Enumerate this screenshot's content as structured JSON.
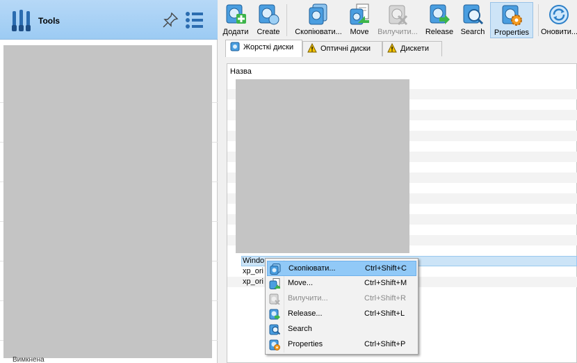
{
  "left_panel": {
    "title": "Tools",
    "bottom_text": "Вимкнена"
  },
  "toolbar": {
    "buttons": [
      {
        "label": "Додати",
        "icon": "add-disk-icon",
        "state": "normal"
      },
      {
        "label": "Create",
        "icon": "create-disk-icon",
        "state": "normal"
      },
      {
        "label": "Скопіювати...",
        "icon": "copy-disk-icon",
        "state": "normal"
      },
      {
        "label": "Move",
        "icon": "move-disk-icon",
        "state": "normal"
      },
      {
        "label": "Вилучити...",
        "icon": "remove-disk-icon",
        "state": "disabled"
      },
      {
        "label": "Release",
        "icon": "release-disk-icon",
        "state": "normal"
      },
      {
        "label": "Search",
        "icon": "search-disk-icon",
        "state": "normal"
      },
      {
        "label": "Properties",
        "icon": "properties-disk-icon",
        "state": "active"
      },
      {
        "label": "Оновити...",
        "icon": "refresh-icon",
        "state": "normal"
      }
    ]
  },
  "tabs": [
    {
      "label": "Жорсткі диски",
      "icon": "hard-disk-icon",
      "active": true
    },
    {
      "label": "Оптичні диски",
      "icon": "warning-icon",
      "active": false
    },
    {
      "label": "Дискети",
      "icon": "warning-icon",
      "active": false
    }
  ],
  "table": {
    "column_header": "Назва",
    "visible_rows": [
      "Windo",
      "xp_ori",
      "xp_ori"
    ]
  },
  "context_menu": {
    "items": [
      {
        "label": "Скопіювати...",
        "shortcut": "Ctrl+Shift+C",
        "icon": "copy-disk-icon",
        "state": "hover"
      },
      {
        "label": "Move...",
        "shortcut": "Ctrl+Shift+M",
        "icon": "move-disk-icon",
        "state": "normal"
      },
      {
        "label": "Вилучити...",
        "shortcut": "Ctrl+Shift+R",
        "icon": "remove-disk-icon",
        "state": "disabled"
      },
      {
        "label": "Release...",
        "shortcut": "Ctrl+Shift+L",
        "icon": "release-disk-icon",
        "state": "normal"
      },
      {
        "label": "Search",
        "shortcut": "",
        "icon": "search-disk-icon",
        "state": "normal"
      },
      {
        "label": "Properties",
        "shortcut": "Ctrl+Shift+P",
        "icon": "properties-disk-icon",
        "state": "normal"
      }
    ]
  },
  "colors": {
    "header_blue": "#9ccbf3",
    "selection": "#cce4f7",
    "menu_hover": "#91c9f7",
    "icon_blue": "#3a8fd6",
    "icon_green": "#3db54a",
    "warning_yellow": "#f5c400"
  }
}
